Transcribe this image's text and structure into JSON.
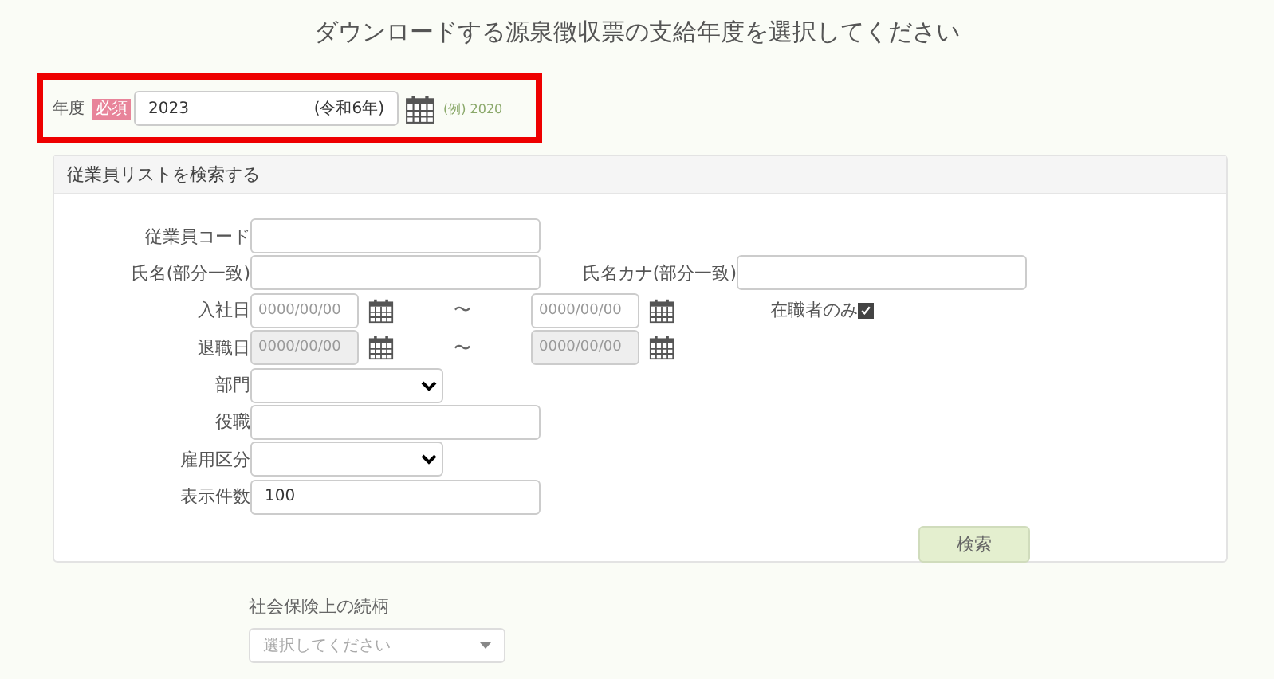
{
  "title": "ダウンロードする源泉徴収票の支給年度を選択してください",
  "year": {
    "label": "年度",
    "required_badge": "必須",
    "value": "2023",
    "era": "(令和6年)",
    "example": "(例) 2020"
  },
  "search_panel": {
    "title": "従業員リストを検索する",
    "rows": [
      {
        "kind": "text",
        "label": "従業員コード"
      },
      {
        "kind": "text-pair",
        "label": "氏名(部分一致)",
        "label2": "氏名カナ(部分一致)"
      },
      {
        "kind": "date-range",
        "label": "入社日",
        "from_placeholder": "0000/00/00",
        "separator": "〜",
        "to_placeholder": "0000/00/00",
        "disabled": false,
        "option": {
          "label": "在職者のみ",
          "checked": true
        }
      },
      {
        "kind": "date-range",
        "label": "退職日",
        "from_placeholder": "0000/00/00",
        "separator": "〜",
        "to_placeholder": "0000/00/00",
        "disabled": true
      },
      {
        "kind": "select",
        "label": "部門"
      },
      {
        "kind": "text",
        "label": "役職"
      },
      {
        "kind": "select",
        "label": "雇用区分"
      },
      {
        "kind": "text",
        "label": "表示件数",
        "value": "100"
      }
    ],
    "search_button": "検索"
  },
  "relation": {
    "label": "社会保険上の続柄",
    "placeholder": "選択してください"
  }
}
